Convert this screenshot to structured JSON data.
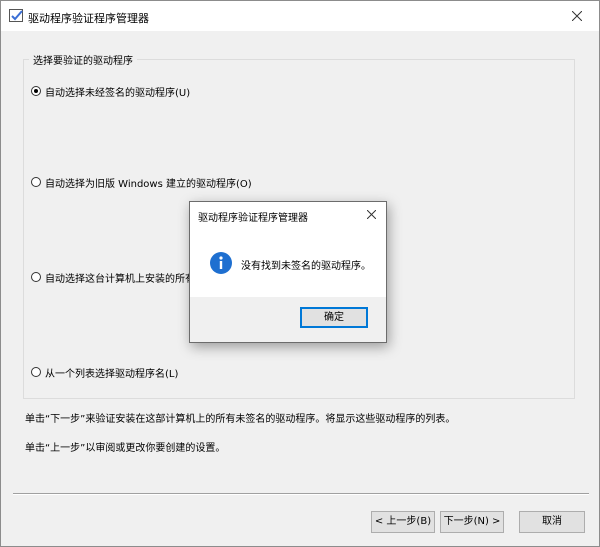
{
  "window": {
    "title": "驱动程序验证程序管理器"
  },
  "groupbox": {
    "legend": "选择要验证的驱动程序",
    "options": [
      {
        "label": "自动选择未经签名的驱动程序(U)",
        "checked": true
      },
      {
        "label": "自动选择为旧版 Windows 建立的驱动程序(O)",
        "checked": false
      },
      {
        "label": "自动选择这台计算机上安装的所有驱",
        "checked": false
      },
      {
        "label": "从一个列表选择驱动程序名(L)",
        "checked": false
      }
    ]
  },
  "description": {
    "line1": "单击“下一步”来验证安装在这部计算机上的所有未签名的驱动程序。将显示这些驱动程序的列表。",
    "line2": "单击“上一步”以审阅或更改你要创建的设置。"
  },
  "buttons": {
    "back": "< 上一步(B)",
    "next": "下一步(N) >",
    "cancel": "取消"
  },
  "dialog": {
    "title": "驱动程序验证程序管理器",
    "message": "没有找到未签名的驱动程序。",
    "ok": "确定",
    "icon": "info-icon"
  }
}
